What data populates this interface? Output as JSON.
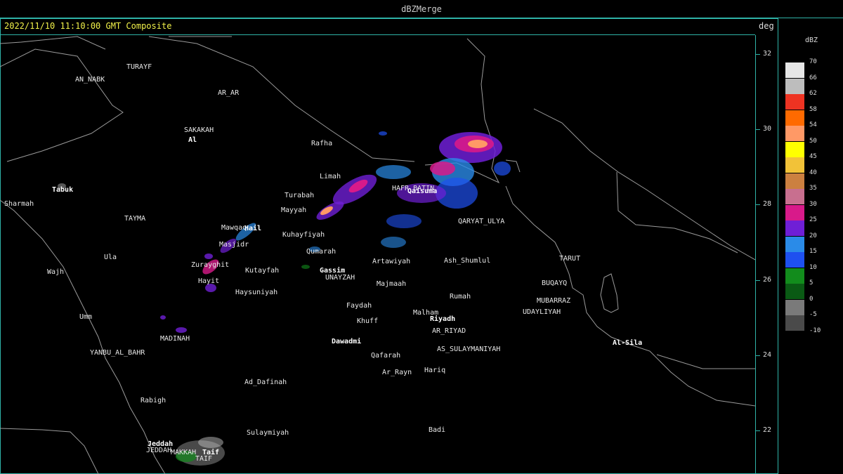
{
  "window": {
    "title": "dBZMerge"
  },
  "info": {
    "timestamp": "2022/11/10 11:10:00 GMT Composite",
    "axis_unit": "deg"
  },
  "axis": {
    "latitudes": [
      "32",
      "30",
      "28",
      "26",
      "24",
      "22"
    ]
  },
  "legend": {
    "title": "dBZ",
    "levels": [
      {
        "value": "70",
        "color": "#e6e6e6"
      },
      {
        "value": "66",
        "color": "#bdbdbd"
      },
      {
        "value": "62",
        "color": "#ee3322"
      },
      {
        "value": "58",
        "color": "#ff6a00"
      },
      {
        "value": "54",
        "color": "#ff9966"
      },
      {
        "value": "50",
        "color": "#ffff00"
      },
      {
        "value": "45",
        "color": "#f2c238"
      },
      {
        "value": "40",
        "color": "#cc8040"
      },
      {
        "value": "35",
        "color": "#c86f8f"
      },
      {
        "value": "30",
        "color": "#d81a8a"
      },
      {
        "value": "25",
        "color": "#6f1fd6"
      },
      {
        "value": "20",
        "color": "#2a8be8"
      },
      {
        "value": "15",
        "color": "#1e50f0"
      },
      {
        "value": "10",
        "color": "#128c1c"
      },
      {
        "value": "5",
        "color": "#0a5a14"
      },
      {
        "value": "0",
        "color": "#7a7a7a"
      },
      {
        "value": "-5",
        "color": "#4a4a4a"
      },
      {
        "value": "-10",
        "color": "#000000"
      }
    ]
  },
  "cities": [
    {
      "name": "TURAYF"
    },
    {
      "name": "AN_NABK"
    },
    {
      "name": "AR_AR"
    },
    {
      "name": "SAKAKAH"
    },
    {
      "name": "Al"
    },
    {
      "name": "Rafha"
    },
    {
      "name": "Limah"
    },
    {
      "name": "Turabah"
    },
    {
      "name": "Tabuk"
    },
    {
      "name": "Sharmah"
    },
    {
      "name": "TAYMA"
    },
    {
      "name": "Mawqaq"
    },
    {
      "name": "Hail"
    },
    {
      "name": "Mayyah"
    },
    {
      "name": "Kuhayfiyah"
    },
    {
      "name": "Masjidr"
    },
    {
      "name": "Qumarah"
    },
    {
      "name": "Ula"
    },
    {
      "name": "Zurayghit"
    },
    {
      "name": "Kutayfah"
    },
    {
      "name": "Gassim"
    },
    {
      "name": "UNAYZAH"
    },
    {
      "name": "Wajh"
    },
    {
      "name": "Hayit"
    },
    {
      "name": "Haysuniyah"
    },
    {
      "name": "HAFR_BATIN"
    },
    {
      "name": "Qaisuma"
    },
    {
      "name": "QARYAT_ULYA"
    },
    {
      "name": "Artawiyah"
    },
    {
      "name": "Ash_Shumlul"
    },
    {
      "name": "Majmaah"
    },
    {
      "name": "Rumah"
    },
    {
      "name": "TARUT"
    },
    {
      "name": "BUQAYQ"
    },
    {
      "name": "MUBARRAZ"
    },
    {
      "name": "UDAYLIYAH"
    },
    {
      "name": "Faydah"
    },
    {
      "name": "Malham"
    },
    {
      "name": "Riyadh"
    },
    {
      "name": "Khuff"
    },
    {
      "name": "AR_RIYAD"
    },
    {
      "name": "Umm"
    },
    {
      "name": "Dawadmi"
    },
    {
      "name": "MADINAH"
    },
    {
      "name": "YANBU_AL_BAHR"
    },
    {
      "name": "AS_SULAYMANIYAH"
    },
    {
      "name": "Qafarah"
    },
    {
      "name": "Al-Sila"
    },
    {
      "name": "Ar_Rayn"
    },
    {
      "name": "Hariq"
    },
    {
      "name": "Ad_Dafinah"
    },
    {
      "name": "Rabigh"
    },
    {
      "name": "Sulaymiyah"
    },
    {
      "name": "Badi"
    },
    {
      "name": "Jeddah"
    },
    {
      "name": "JEDDAH"
    },
    {
      "name": "MAKKAH"
    },
    {
      "name": "Taif"
    },
    {
      "name": "TAIF"
    }
  ]
}
